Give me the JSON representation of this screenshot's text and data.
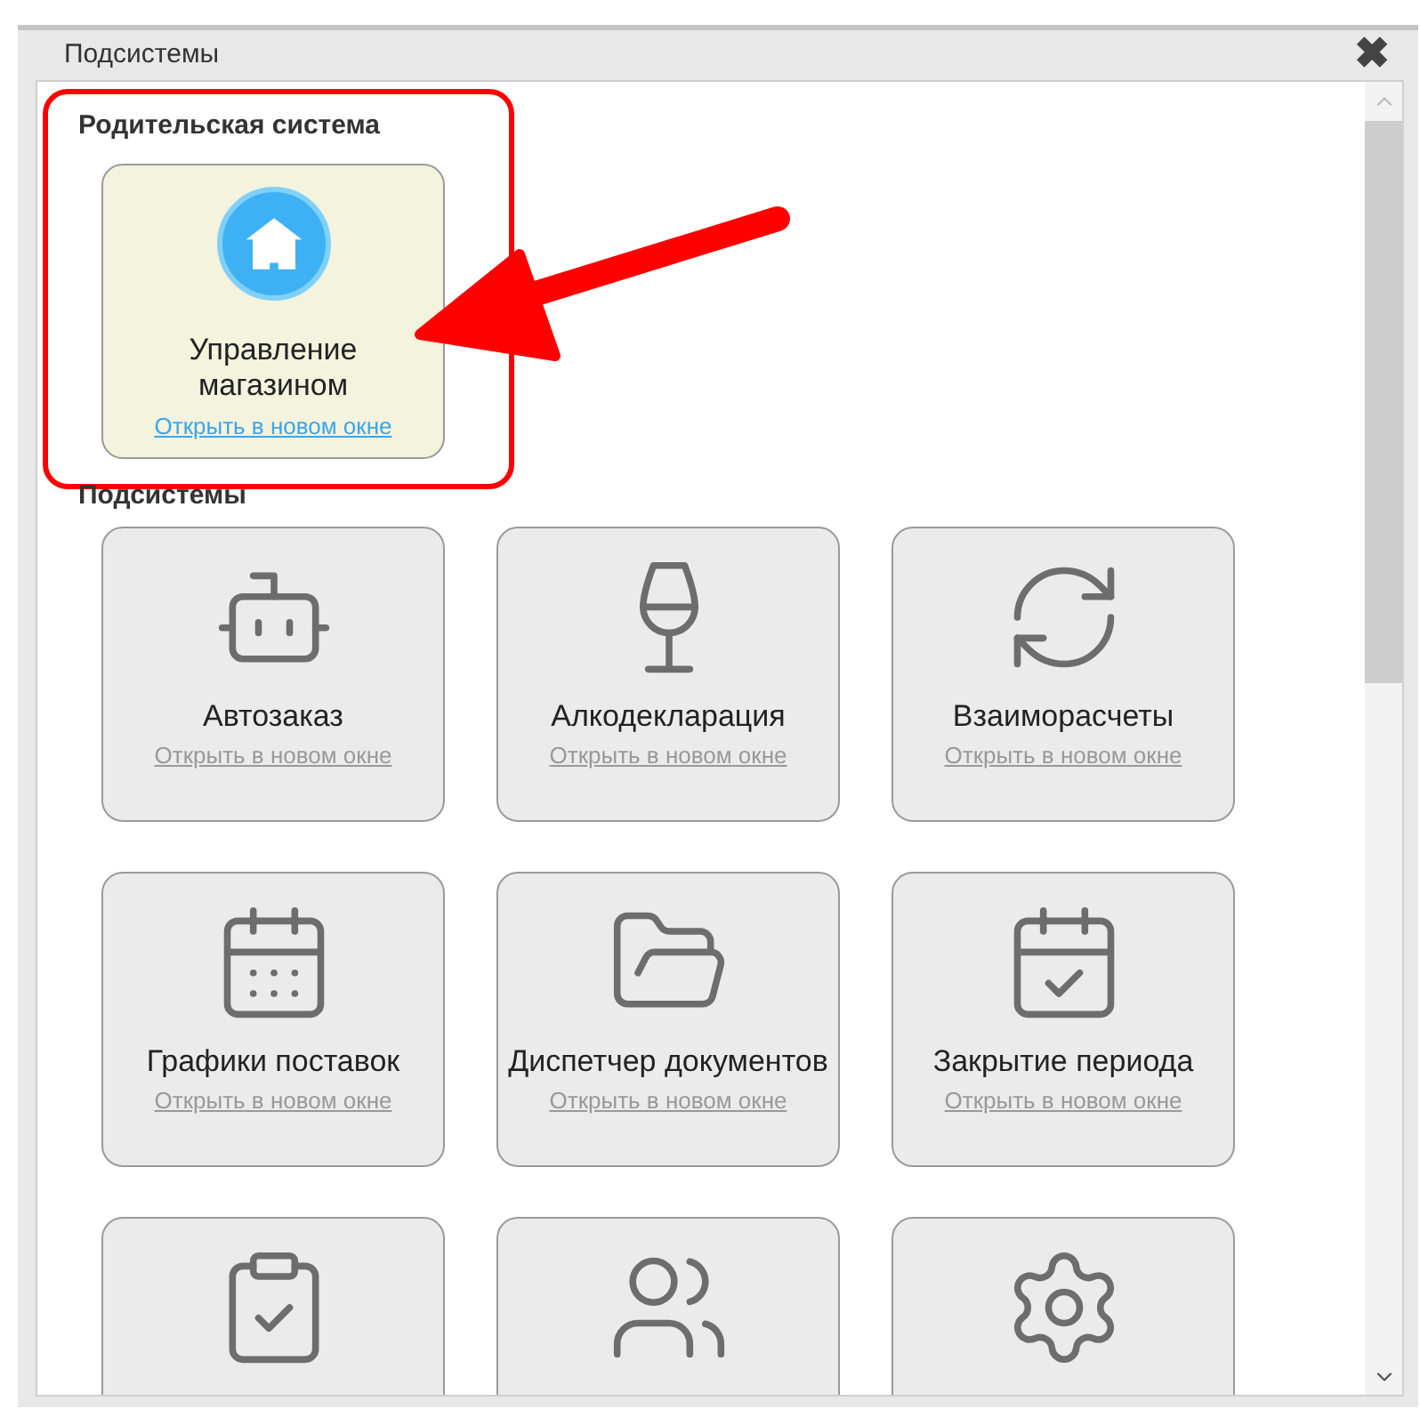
{
  "window": {
    "title": "Подсистемы",
    "close": "✖"
  },
  "parent_section": {
    "heading": "Родительская система",
    "item": {
      "title": "Управление магазином",
      "link": "Открыть в новом окне"
    }
  },
  "subsystems_section": {
    "heading": "Подсистемы",
    "items": [
      {
        "kind": "full",
        "title": "Автозаказ",
        "link": "Открыть в новом окне"
      },
      {
        "kind": "full",
        "title": "Алкодекларация",
        "link": "Открыть в новом окне"
      },
      {
        "kind": "full",
        "title": "Взаиморасчеты",
        "link": "Открыть в новом окне"
      },
      {
        "kind": "full",
        "title": "Графики поставок",
        "link": "Открыть в новом окне"
      },
      {
        "kind": "full",
        "title": "Диспетчер документов",
        "link": "Открыть в новом окне"
      },
      {
        "kind": "full",
        "title": "Закрытие периода",
        "link": "Открыть в новом окне"
      },
      {
        "kind": "cut_off"
      },
      {
        "kind": "cut_off"
      },
      {
        "kind": "cut_off"
      }
    ]
  }
}
